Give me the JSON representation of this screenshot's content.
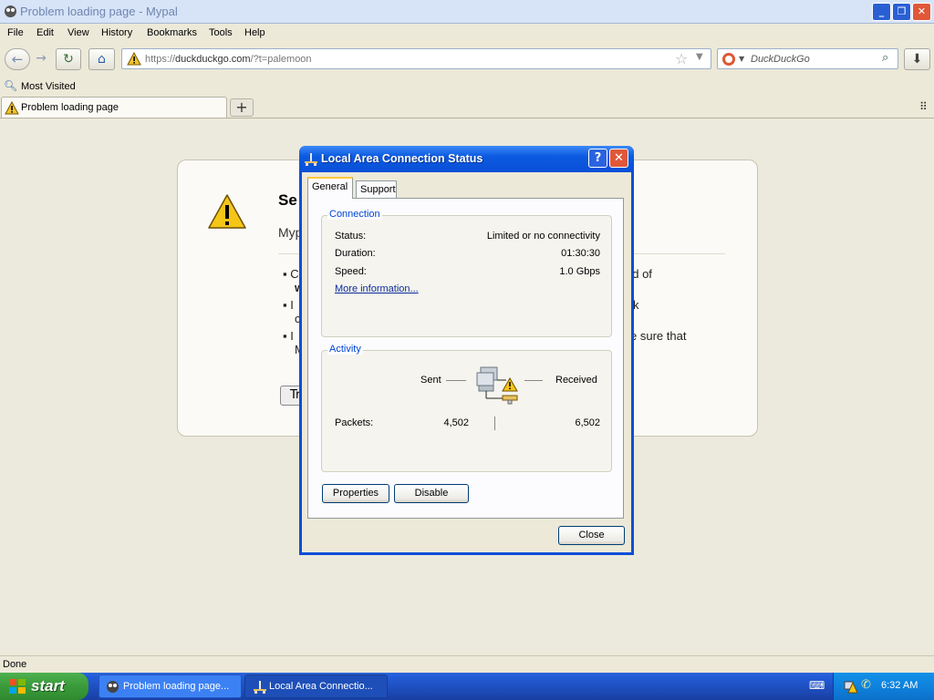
{
  "window": {
    "title": "Problem loading page - Mypal"
  },
  "menubar": [
    "File",
    "Edit",
    "View",
    "History",
    "Bookmarks",
    "Tools",
    "Help"
  ],
  "navigation": {
    "url_prefix": "https://",
    "url_domain": "duckduckgo.com",
    "url_suffix": "/?t=palemoon",
    "search_placeholder": "DuckDuckGo"
  },
  "bookmarks": {
    "most_visited": "Most Visited"
  },
  "tabs": [
    {
      "label": "Problem loading page"
    }
  ],
  "error_page": {
    "title_partial": "Se",
    "subtitle_partial": "Myp",
    "bullets": [
      {
        "left": "C",
        "left2": "w",
        "right": "ad of"
      },
      {
        "left": "I",
        "left2": "c",
        "right": "k"
      },
      {
        "left": "I",
        "left2": "M",
        "right": "e sure that"
      }
    ],
    "button_partial": "Tr"
  },
  "statusbar": {
    "text": "Done"
  },
  "dialog": {
    "title": "Local Area Connection Status",
    "tabs": [
      "General",
      "Support"
    ],
    "connection": {
      "legend": "Connection",
      "status_label": "Status:",
      "status_value": "Limited or no connectivity",
      "duration_label": "Duration:",
      "duration_value": "01:30:30",
      "speed_label": "Speed:",
      "speed_value": "1.0 Gbps",
      "more_info": "More information..."
    },
    "activity": {
      "legend": "Activity",
      "sent_label": "Sent",
      "received_label": "Received",
      "packets_label": "Packets:",
      "packets_sent": "4,502",
      "packets_received": "6,502"
    },
    "buttons": {
      "properties": "Properties",
      "disable": "Disable",
      "close": "Close"
    }
  },
  "taskbar": {
    "start": "start",
    "tasks": [
      "Problem loading page...",
      "Local Area Connectio..."
    ],
    "clock": "6:32 AM"
  }
}
